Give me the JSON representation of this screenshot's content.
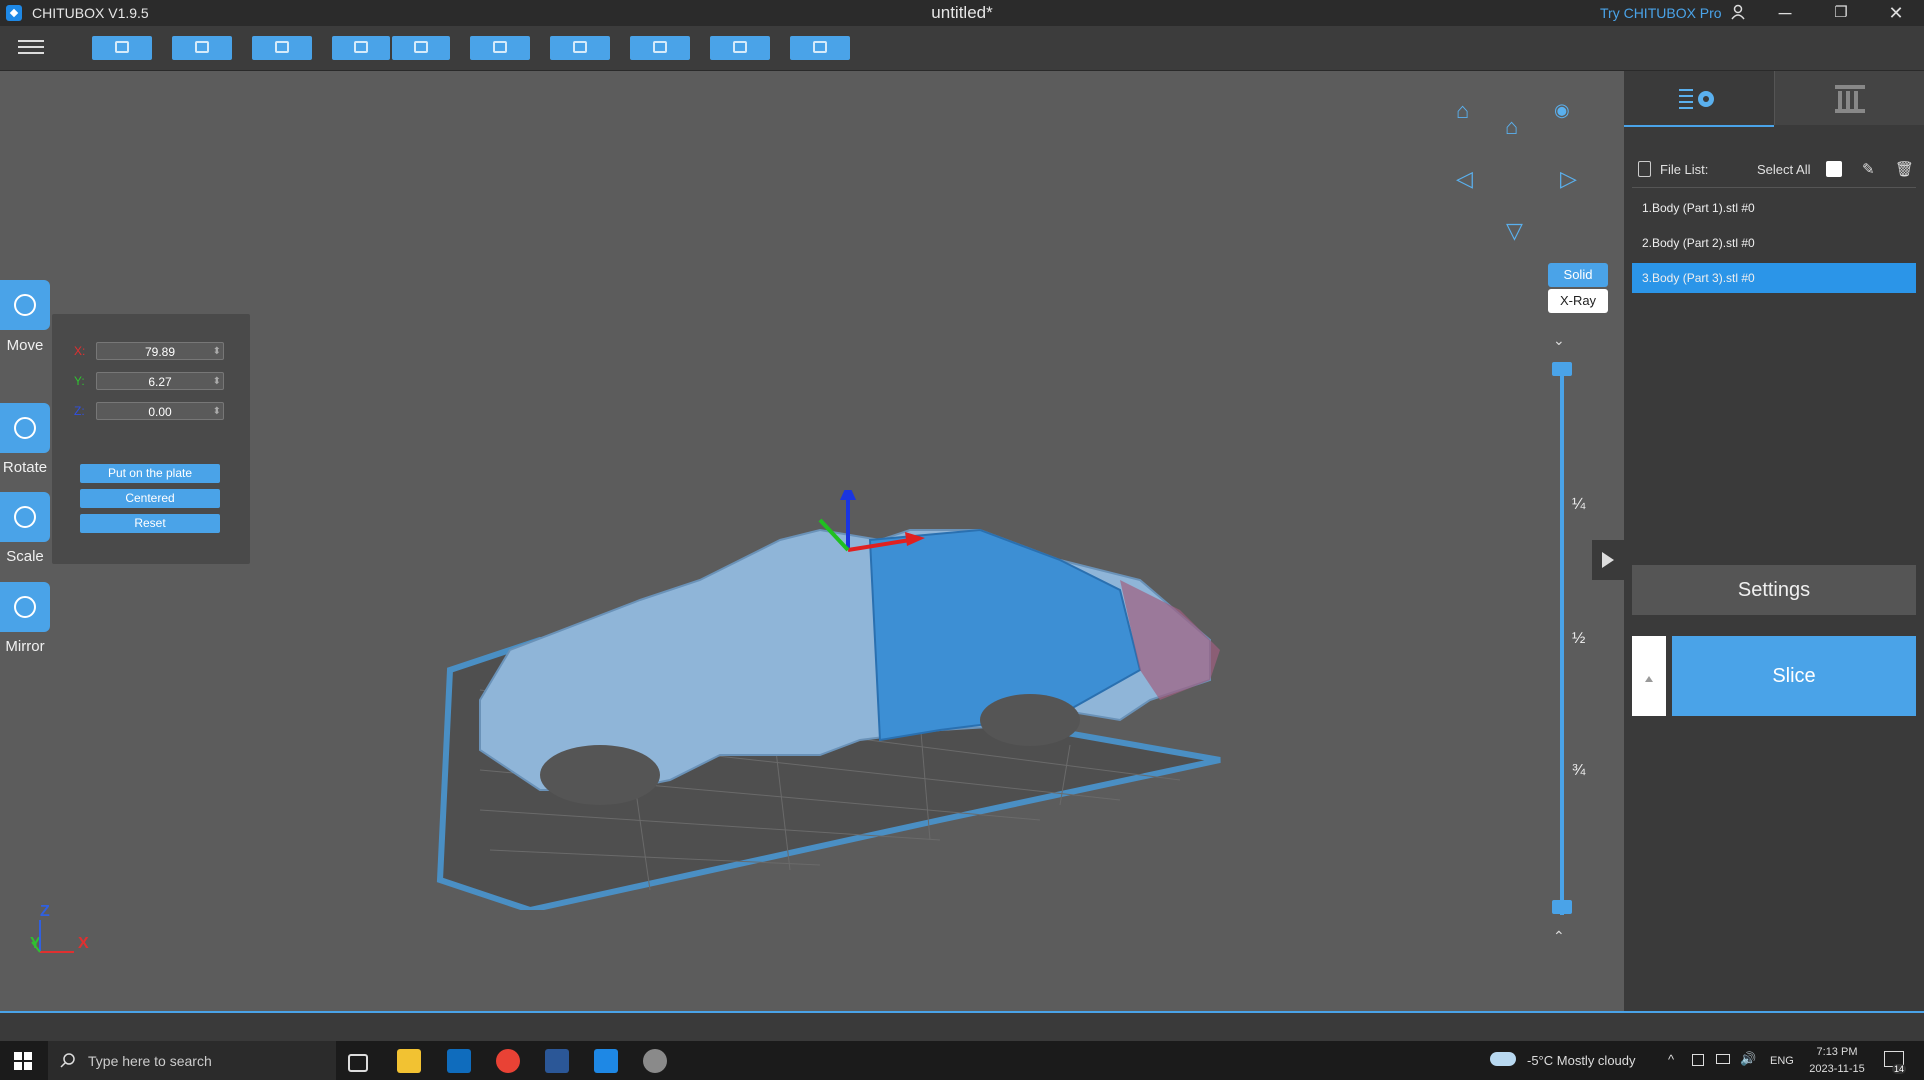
{
  "app": {
    "title": "CHITUBOX V1.9.5",
    "document": "untitled*",
    "try_pro": "Try CHITUBOX Pro"
  },
  "window_controls": {
    "minimize": "─",
    "restore": "❐",
    "close": "✕"
  },
  "toolbar": {
    "buttons": [
      "open-file-icon",
      "save-icon",
      "auto-layout-icon",
      "undo-icon",
      "redo-icon",
      "copy-icon",
      "group-icon",
      "support-icon",
      "hollow-icon",
      "dig-hole-icon"
    ]
  },
  "tools": {
    "move": "Move",
    "rotate": "Rotate",
    "scale": "Scale",
    "mirror": "Mirror"
  },
  "move_panel": {
    "x_label": "X:",
    "y_label": "Y:",
    "z_label": "Z:",
    "x_value": "79.89",
    "y_value": "6.27",
    "z_value": "0.00",
    "put_on_plate": "Put on the plate",
    "centered": "Centered",
    "reset": "Reset"
  },
  "view": {
    "solid": "Solid",
    "xray": "X-Ray"
  },
  "layer_slider": {
    "quarter": "¼",
    "half": "½",
    "three_quarter": "¾"
  },
  "axis_gizmo": {
    "z": "Z",
    "y": "Y",
    "x": "X"
  },
  "right_panel": {
    "file_list_label": "File List:",
    "select_all": "Select All",
    "files": [
      {
        "name": "1.Body (Part 1).stl #0",
        "selected": false
      },
      {
        "name": "2.Body (Part 2).stl #0",
        "selected": false
      },
      {
        "name": "3.Body (Part 3).stl #0",
        "selected": true
      }
    ],
    "settings": "Settings",
    "slice": "Slice"
  },
  "taskbar": {
    "search_placeholder": "Type here to search",
    "weather": "-5°C  Mostly cloudy",
    "language": "ENG",
    "time": "7:13 PM",
    "date": "2023-11-15",
    "notifications": "14"
  },
  "colors": {
    "accent": "#4aa3e8",
    "selected": "#2b95e8",
    "panel": "#3a3a3a",
    "viewport": "#5c5c5c"
  }
}
